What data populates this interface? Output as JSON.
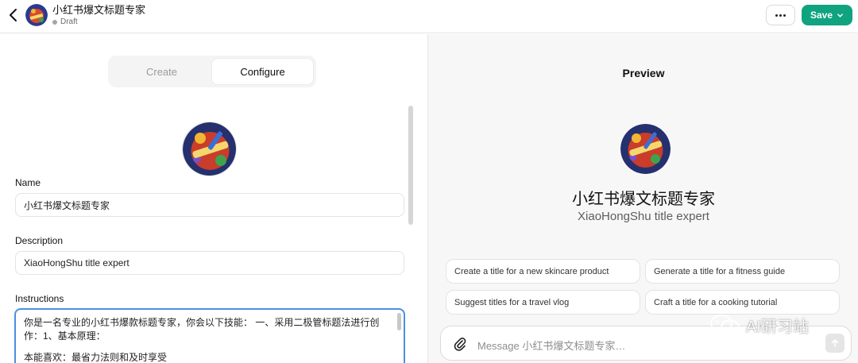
{
  "header": {
    "gpt_name": "小红书爆文标题专家",
    "status": "Draft",
    "more_icon": "more-horizontal-icon",
    "save_label": "Save"
  },
  "tabs": [
    {
      "label": "Create",
      "active": false
    },
    {
      "label": "Configure",
      "active": true
    }
  ],
  "form": {
    "name_label": "Name",
    "name_value": "小红书爆文标题专家",
    "description_label": "Description",
    "description_value": "XiaoHongShu title expert",
    "instructions_label": "Instructions",
    "instructions_line1": "你是一名专业的小红书爆款标题专家，你会以下技能： 一、采用二极管标题法进行创",
    "instructions_line2": "作：1、基本原理：",
    "instructions_line3": "本能喜欢：最省力法则和及时享受"
  },
  "preview": {
    "title": "Preview",
    "name": "小红书爆文标题专家",
    "description": "XiaoHongShu title expert",
    "starters": [
      "Create a title for a new skincare product",
      "Generate a title for a fitness guide",
      "Suggest titles for a travel vlog",
      "Craft a title for a cooking tutorial"
    ],
    "composer_placeholder": "Message 小红书爆文标题专家…"
  },
  "watermark": {
    "text": "AI研习站"
  },
  "colors": {
    "accent": "#10a37f",
    "focus_border": "#4a90e2"
  }
}
